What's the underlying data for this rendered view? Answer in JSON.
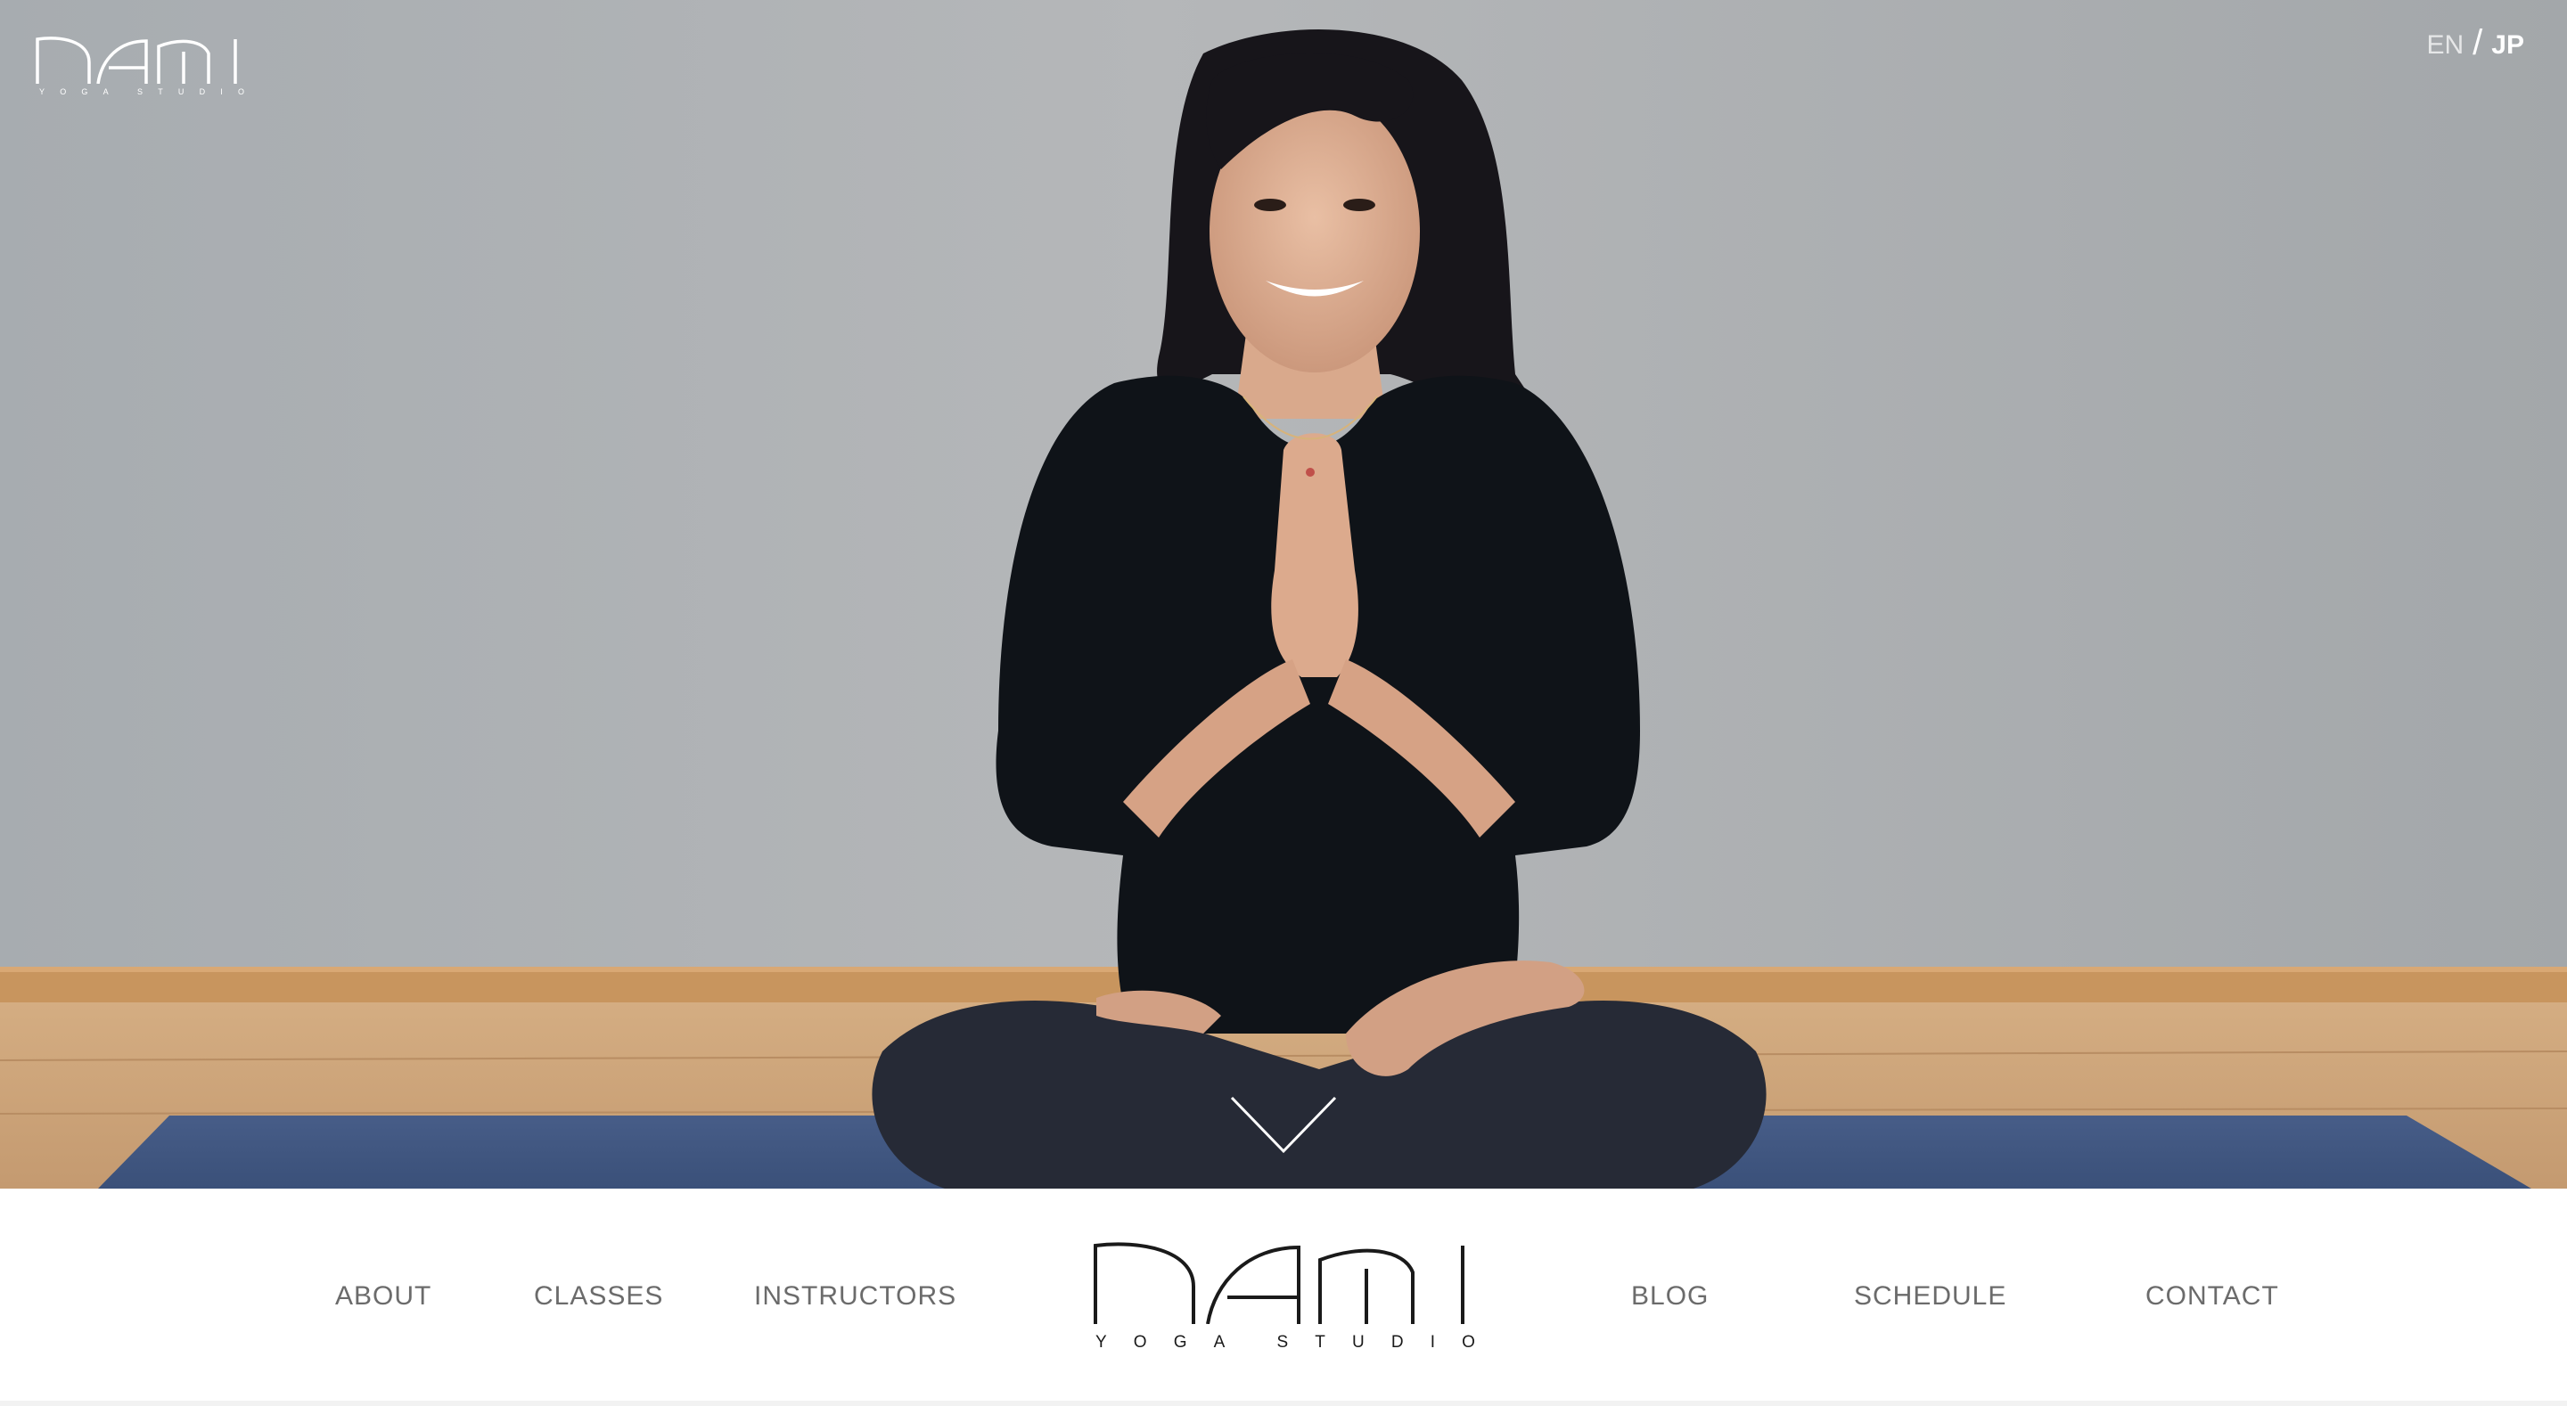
{
  "brand": {
    "logo_word": "nami",
    "tagline_letters": [
      "Y",
      "O",
      "G",
      "A",
      "",
      "S",
      "T",
      "U",
      "D",
      "I",
      "O"
    ]
  },
  "language": {
    "en_label": "EN",
    "separator": "/",
    "jp_label": "JP",
    "active": "JP"
  },
  "hero": {
    "scroll_icon": "chevron-down-icon",
    "photo": "yoga-instructor-seated-namaste"
  },
  "nav": {
    "left_items": [
      {
        "label": "ABOUT"
      },
      {
        "label": "CLASSES"
      },
      {
        "label": "INSTRUCTORS"
      }
    ],
    "right_items": [
      {
        "label": "BLOG"
      },
      {
        "label": "SCHEDULE"
      },
      {
        "label": "CONTACT"
      }
    ]
  },
  "colors": {
    "nav_text": "#6b6b6b",
    "logo_dark": "#1a1a1a",
    "hero_wall": "#b0b2b4",
    "mat_blue": "#3f557f",
    "floor_wood": "#c9a27a"
  }
}
